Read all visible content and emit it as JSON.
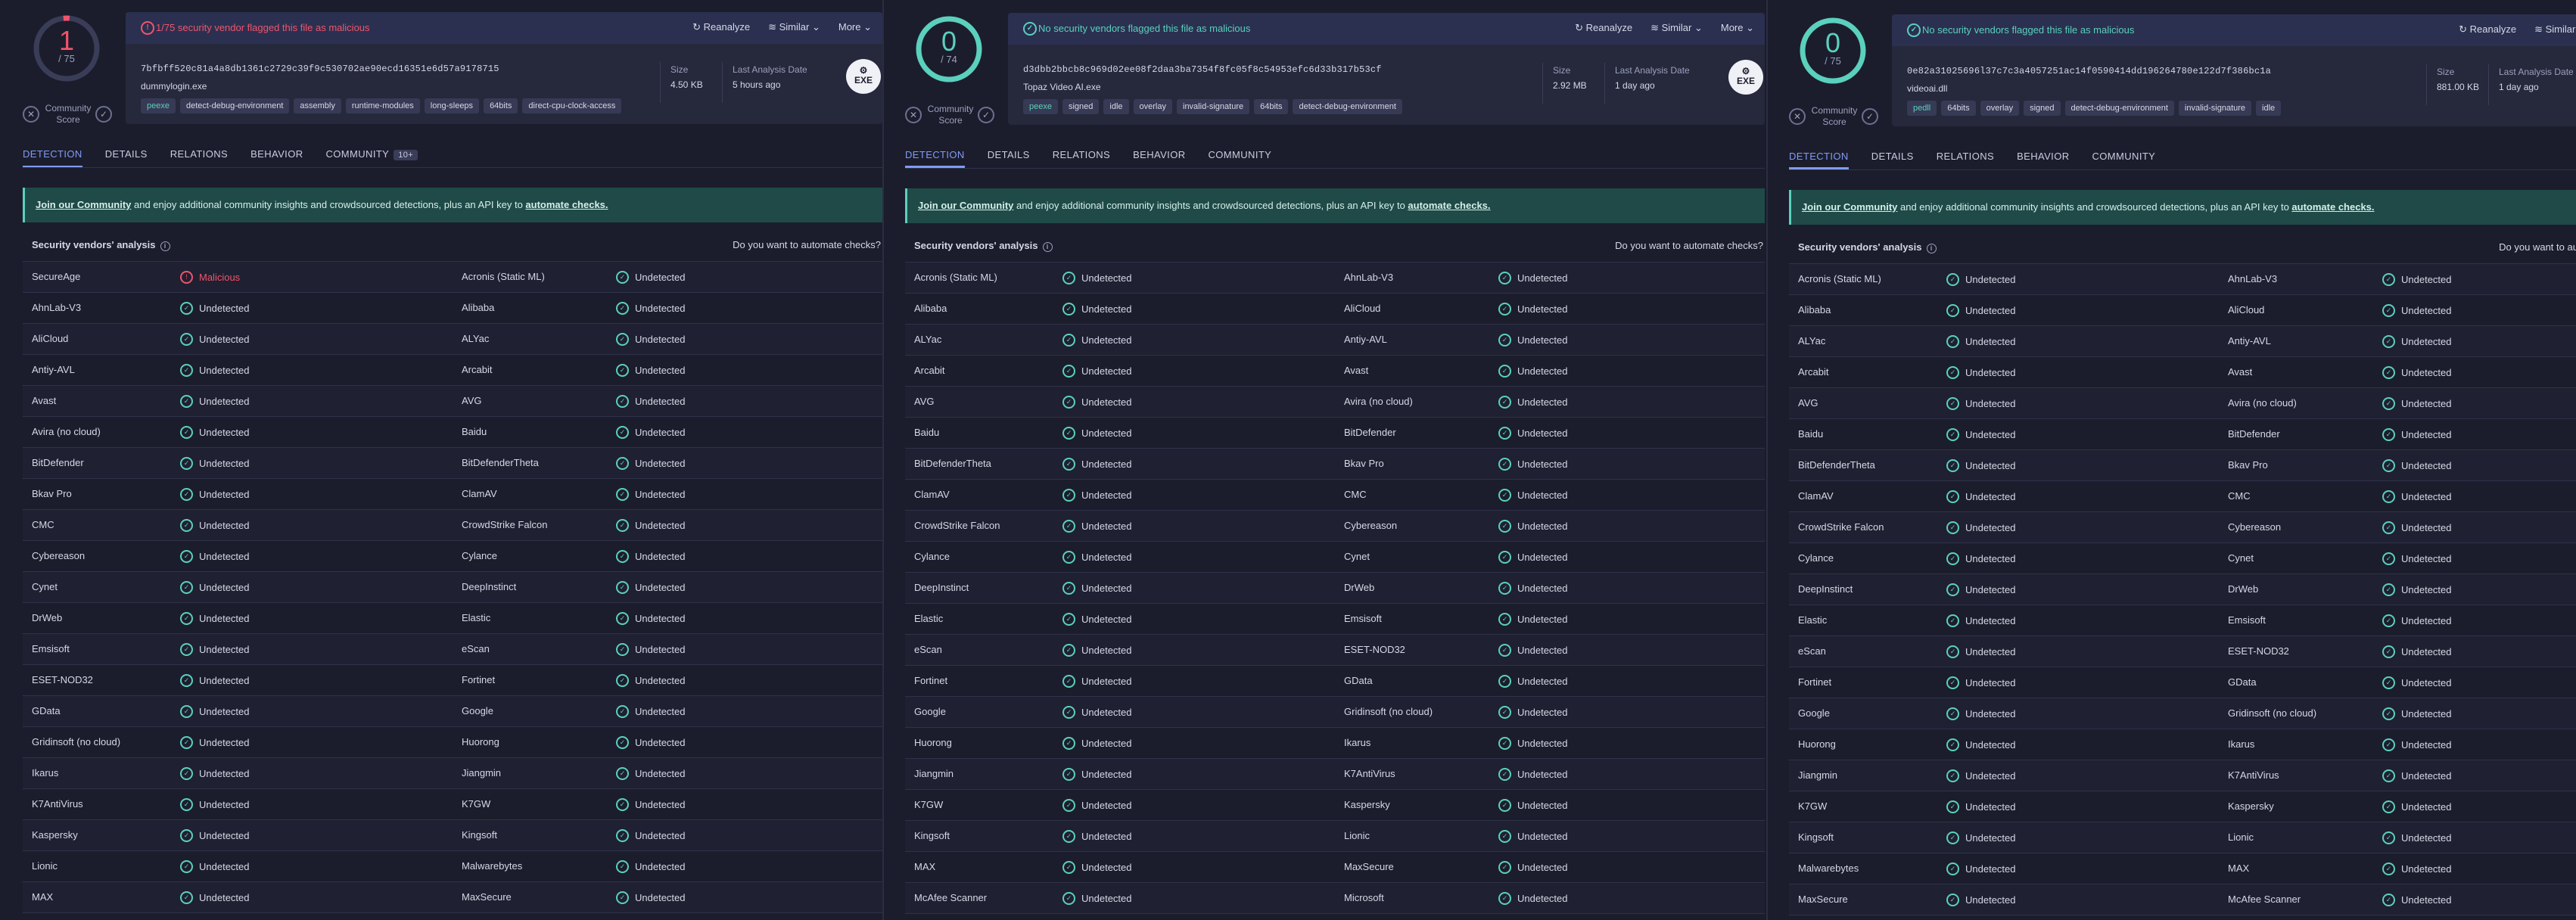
{
  "colors": {
    "accent": "#7f9cf5",
    "success": "#5ad0bd",
    "danger": "#f0546c",
    "bg": "#1c1d2c"
  },
  "labels": {
    "community_score": "Community Score",
    "reanalyze": "Reanalyze",
    "similar": "Similar",
    "more": "More",
    "size": "Size",
    "last_analysis_date": "Last Analysis Date",
    "banner_link": "Join our Community",
    "banner_mid": " and enjoy additional community insights and crowdsourced detections, plus an API key to ",
    "banner_link2": "automate checks.",
    "vendors_analysis": "Security vendors' analysis",
    "automate_question": "Do you want to automate checks?",
    "exe": "EXE"
  },
  "panels": [
    {
      "score": "1",
      "score_total": "/ 75",
      "alert": "1/75 security vendor flagged this file as malicious",
      "alert_type": "danger",
      "hash": "7bfbff520c81a4a8db1361c2729c39f9c530702ae90ecd16351e6d57a9178715",
      "filename": "dummylogin.exe",
      "size": "4.50 KB",
      "date": "5 hours ago",
      "show_icon": true,
      "tags": [
        "peexe",
        "detect-debug-environment",
        "assembly",
        "runtime-modules",
        "long-sleeps",
        "64bits",
        "direct-cpu-clock-access"
      ],
      "tabs": [
        "DETECTION",
        "DETAILS",
        "RELATIONS",
        "BEHAVIOR",
        "COMMUNITY"
      ],
      "community_badge": "10+",
      "rows": [
        [
          "SecureAge",
          "Malicious",
          "Acronis (Static ML)",
          "Undetected"
        ],
        [
          "AhnLab-V3",
          "Undetected",
          "Alibaba",
          "Undetected"
        ],
        [
          "AliCloud",
          "Undetected",
          "ALYac",
          "Undetected"
        ],
        [
          "Antiy-AVL",
          "Undetected",
          "Arcabit",
          "Undetected"
        ],
        [
          "Avast",
          "Undetected",
          "AVG",
          "Undetected"
        ],
        [
          "Avira (no cloud)",
          "Undetected",
          "Baidu",
          "Undetected"
        ],
        [
          "BitDefender",
          "Undetected",
          "BitDefenderTheta",
          "Undetected"
        ],
        [
          "Bkav Pro",
          "Undetected",
          "ClamAV",
          "Undetected"
        ],
        [
          "CMC",
          "Undetected",
          "CrowdStrike Falcon",
          "Undetected"
        ],
        [
          "Cybereason",
          "Undetected",
          "Cylance",
          "Undetected"
        ],
        [
          "Cynet",
          "Undetected",
          "DeepInstinct",
          "Undetected"
        ],
        [
          "DrWeb",
          "Undetected",
          "Elastic",
          "Undetected"
        ],
        [
          "Emsisoft",
          "Undetected",
          "eScan",
          "Undetected"
        ],
        [
          "ESET-NOD32",
          "Undetected",
          "Fortinet",
          "Undetected"
        ],
        [
          "GData",
          "Undetected",
          "Google",
          "Undetected"
        ],
        [
          "Gridinsoft (no cloud)",
          "Undetected",
          "Huorong",
          "Undetected"
        ],
        [
          "Ikarus",
          "Undetected",
          "Jiangmin",
          "Undetected"
        ],
        [
          "K7AntiVirus",
          "Undetected",
          "K7GW",
          "Undetected"
        ],
        [
          "Kaspersky",
          "Undetected",
          "Kingsoft",
          "Undetected"
        ],
        [
          "Lionic",
          "Undetected",
          "Malwarebytes",
          "Undetected"
        ],
        [
          "MAX",
          "Undetected",
          "MaxSecure",
          "Undetected"
        ]
      ]
    },
    {
      "score": "0",
      "score_total": "/ 74",
      "alert": "No security vendors flagged this file as malicious",
      "alert_type": "ok",
      "hash": "d3dbb2bbcb8c969d02ee08f2daa3ba7354f8fc05f8c54953efc6d33b317b53cf",
      "filename": "Topaz Video AI.exe",
      "size": "2.92 MB",
      "date": "1 day ago",
      "show_icon": true,
      "tags": [
        "peexe",
        "signed",
        "idle",
        "overlay",
        "invalid-signature",
        "64bits",
        "detect-debug-environment"
      ],
      "tabs": [
        "DETECTION",
        "DETAILS",
        "RELATIONS",
        "BEHAVIOR",
        "COMMUNITY"
      ],
      "community_badge": "",
      "rows": [
        [
          "Acronis (Static ML)",
          "Undetected",
          "AhnLab-V3",
          "Undetected"
        ],
        [
          "Alibaba",
          "Undetected",
          "AliCloud",
          "Undetected"
        ],
        [
          "ALYac",
          "Undetected",
          "Antiy-AVL",
          "Undetected"
        ],
        [
          "Arcabit",
          "Undetected",
          "Avast",
          "Undetected"
        ],
        [
          "AVG",
          "Undetected",
          "Avira (no cloud)",
          "Undetected"
        ],
        [
          "Baidu",
          "Undetected",
          "BitDefender",
          "Undetected"
        ],
        [
          "BitDefenderTheta",
          "Undetected",
          "Bkav Pro",
          "Undetected"
        ],
        [
          "ClamAV",
          "Undetected",
          "CMC",
          "Undetected"
        ],
        [
          "CrowdStrike Falcon",
          "Undetected",
          "Cybereason",
          "Undetected"
        ],
        [
          "Cylance",
          "Undetected",
          "Cynet",
          "Undetected"
        ],
        [
          "DeepInstinct",
          "Undetected",
          "DrWeb",
          "Undetected"
        ],
        [
          "Elastic",
          "Undetected",
          "Emsisoft",
          "Undetected"
        ],
        [
          "eScan",
          "Undetected",
          "ESET-NOD32",
          "Undetected"
        ],
        [
          "Fortinet",
          "Undetected",
          "GData",
          "Undetected"
        ],
        [
          "Google",
          "Undetected",
          "Gridinsoft (no cloud)",
          "Undetected"
        ],
        [
          "Huorong",
          "Undetected",
          "Ikarus",
          "Undetected"
        ],
        [
          "Jiangmin",
          "Undetected",
          "K7AntiVirus",
          "Undetected"
        ],
        [
          "K7GW",
          "Undetected",
          "Kaspersky",
          "Undetected"
        ],
        [
          "Kingsoft",
          "Undetected",
          "Lionic",
          "Undetected"
        ],
        [
          "MAX",
          "Undetected",
          "MaxSecure",
          "Undetected"
        ],
        [
          "McAfee Scanner",
          "Undetected",
          "Microsoft",
          "Undetected"
        ]
      ]
    },
    {
      "score": "0",
      "score_total": "/ 75",
      "alert": "No security vendors flagged this file as malicious",
      "alert_type": "ok",
      "hash": "0e82a31025696l37c7c3a4057251ac14f0590414dd196264780e122d7f386bc1a",
      "filename": "videoai.dll",
      "size": "881.00 KB",
      "date": "1 day ago",
      "show_icon": false,
      "tags": [
        "pedll",
        "64bits",
        "overlay",
        "signed",
        "detect-debug-environment",
        "invalid-signature",
        "idle"
      ],
      "tabs": [
        "DETECTION",
        "DETAILS",
        "RELATIONS",
        "BEHAVIOR",
        "COMMUNITY"
      ],
      "community_badge": "",
      "rows": [
        [
          "Acronis (Static ML)",
          "Undetected",
          "AhnLab-V3",
          "Undetected"
        ],
        [
          "Alibaba",
          "Undetected",
          "AliCloud",
          "Undetected"
        ],
        [
          "ALYac",
          "Undetected",
          "Antiy-AVL",
          "Undetected"
        ],
        [
          "Arcabit",
          "Undetected",
          "Avast",
          "Undetected"
        ],
        [
          "AVG",
          "Undetected",
          "Avira (no cloud)",
          "Undetected"
        ],
        [
          "Baidu",
          "Undetected",
          "BitDefender",
          "Undetected"
        ],
        [
          "BitDefenderTheta",
          "Undetected",
          "Bkav Pro",
          "Undetected"
        ],
        [
          "ClamAV",
          "Undetected",
          "CMC",
          "Undetected"
        ],
        [
          "CrowdStrike Falcon",
          "Undetected",
          "Cybereason",
          "Undetected"
        ],
        [
          "Cylance",
          "Undetected",
          "Cynet",
          "Undetected"
        ],
        [
          "DeepInstinct",
          "Undetected",
          "DrWeb",
          "Undetected"
        ],
        [
          "Elastic",
          "Undetected",
          "Emsisoft",
          "Undetected"
        ],
        [
          "eScan",
          "Undetected",
          "ESET-NOD32",
          "Undetected"
        ],
        [
          "Fortinet",
          "Undetected",
          "GData",
          "Undetected"
        ],
        [
          "Google",
          "Undetected",
          "Gridinsoft (no cloud)",
          "Undetected"
        ],
        [
          "Huorong",
          "Undetected",
          "Ikarus",
          "Undetected"
        ],
        [
          "Jiangmin",
          "Undetected",
          "K7AntiVirus",
          "Undetected"
        ],
        [
          "K7GW",
          "Undetected",
          "Kaspersky",
          "Undetected"
        ],
        [
          "Kingsoft",
          "Undetected",
          "Lionic",
          "Undetected"
        ],
        [
          "Malwarebytes",
          "Undetected",
          "MAX",
          "Undetected"
        ],
        [
          "MaxSecure",
          "Undetected",
          "McAfee Scanner",
          "Undetected"
        ]
      ]
    }
  ]
}
